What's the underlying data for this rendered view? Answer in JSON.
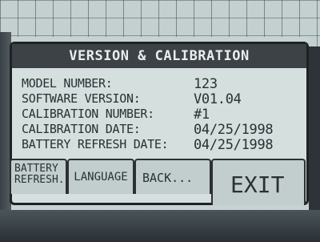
{
  "dialog": {
    "title": "VERSION & CALIBRATION",
    "rows": [
      {
        "label": "MODEL NUMBER:",
        "value": "123"
      },
      {
        "label": "SOFTWARE VERSION:",
        "value": "V01.04"
      },
      {
        "label": "CALIBRATION NUMBER:",
        "value": "#1"
      },
      {
        "label": "CALIBRATION DATE:",
        "value": "04/25/1998"
      },
      {
        "label": "BATTERY REFRESH DATE:",
        "value": "04/25/1998"
      }
    ]
  },
  "softkeys": {
    "battery_line1": "BATTERY",
    "battery_line2": "REFRESH..",
    "language": "LANGUAGE",
    "back": "BACK...",
    "exit": "EXIT"
  },
  "colors": {
    "lcd_background": "#c7d3d2",
    "title_bar": "#3c4245",
    "text": "#2a3033"
  }
}
